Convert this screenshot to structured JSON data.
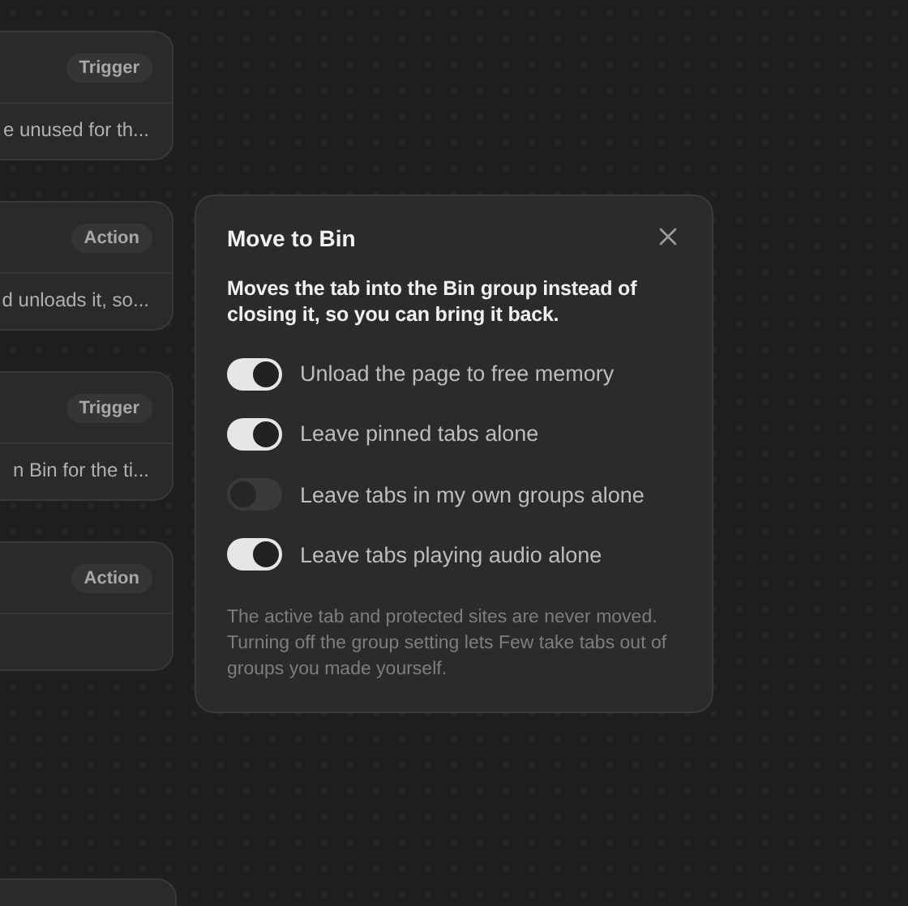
{
  "cards": [
    {
      "badge": "Trigger",
      "description": "e unused for th..."
    },
    {
      "badge": "Action",
      "description": "d unloads it, so..."
    },
    {
      "badge": "Trigger",
      "description": "n Bin for the ti..."
    },
    {
      "badge": "Action"
    }
  ],
  "popover": {
    "title": "Move to Bin",
    "description": "Moves the tab into the Bin group instead of closing it, so you can bring it back.",
    "options": [
      {
        "label": "Unload the page to free memory",
        "on": true
      },
      {
        "label": "Leave pinned tabs alone",
        "on": true
      },
      {
        "label": "Leave tabs in my own groups alone",
        "on": false
      },
      {
        "label": "Leave tabs playing audio alone",
        "on": true
      }
    ],
    "note": "The active tab and protected sites are never moved. Turning off the group setting lets Few take tabs out of groups you made yourself."
  }
}
